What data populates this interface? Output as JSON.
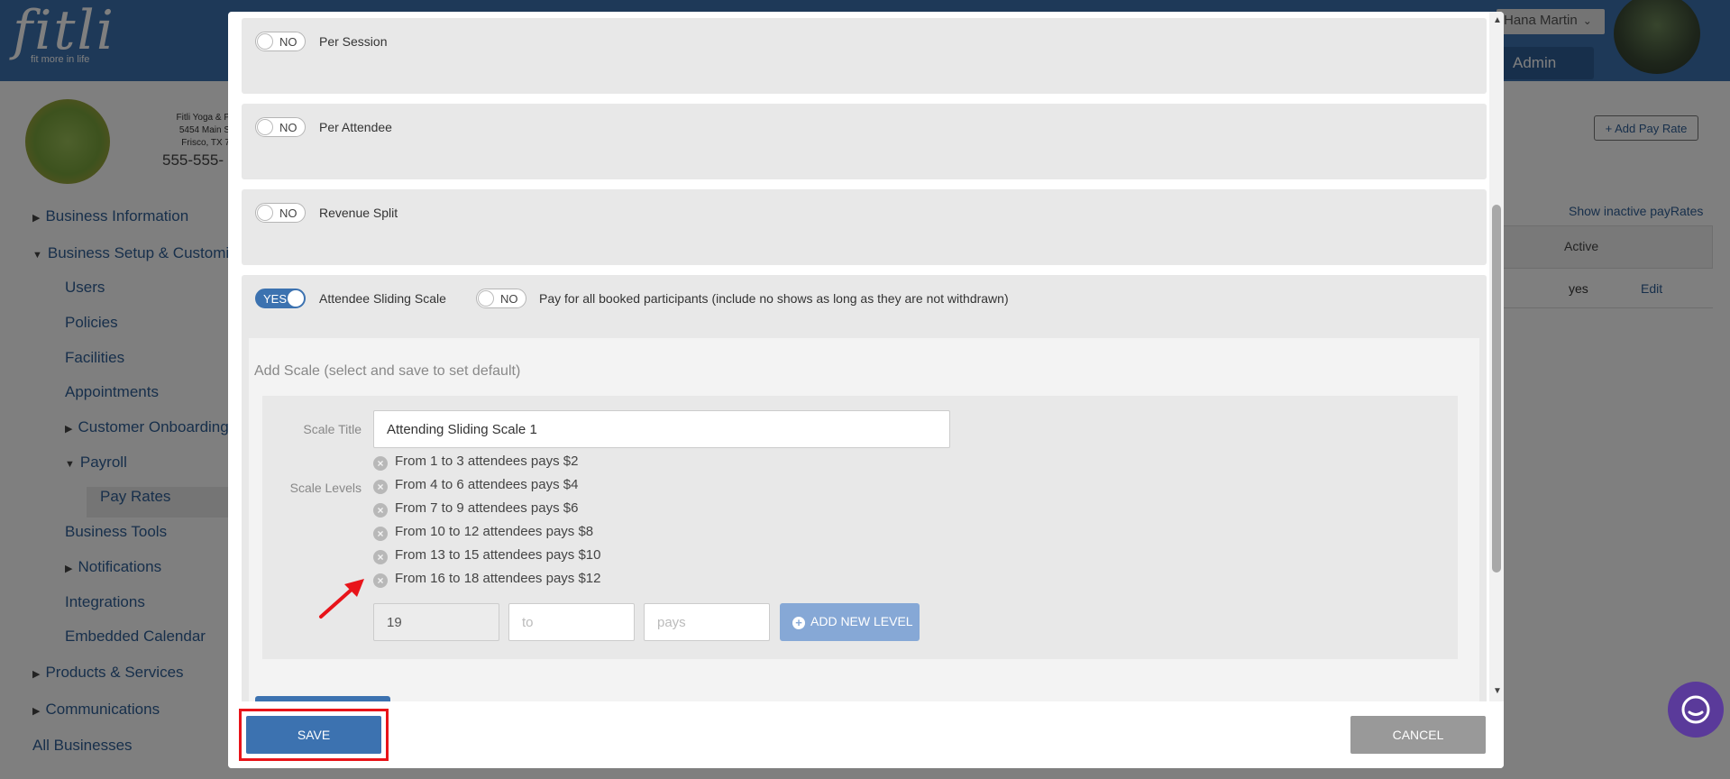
{
  "app": {
    "logo_text": "fitli",
    "logo_tagline": "fit more in life",
    "user_name": "Hana Martin",
    "admin_label": "Admin"
  },
  "business": {
    "name": "Fitli Yoga & P",
    "address_line1": "5454 Main S",
    "address_line2": "Frisco, TX 7",
    "phone": "555-555-"
  },
  "sidebar": {
    "items": [
      {
        "label": "Business Information"
      },
      {
        "label": "Business Setup & Customiza"
      },
      {
        "label": "Users"
      },
      {
        "label": "Policies"
      },
      {
        "label": "Facilities"
      },
      {
        "label": "Appointments"
      },
      {
        "label": "Customer Onboarding"
      },
      {
        "label": "Payroll"
      },
      {
        "label": "Pay Rates"
      },
      {
        "label": "Business Tools"
      },
      {
        "label": "Notifications"
      },
      {
        "label": "Integrations"
      },
      {
        "label": "Embedded Calendar"
      },
      {
        "label": "Products & Services"
      },
      {
        "label": "Communications"
      },
      {
        "label": "All Businesses"
      }
    ]
  },
  "background_page": {
    "add_pay_rate": "+ Add Pay Rate",
    "show_inactive": "Show inactive payRates",
    "table_header_active": "Active",
    "row_active": "yes",
    "row_edit": "Edit"
  },
  "modal": {
    "per_session": {
      "toggle": "NO",
      "label": "Per Session"
    },
    "per_attendee": {
      "toggle": "NO",
      "label": "Per Attendee"
    },
    "revenue_split": {
      "toggle": "NO",
      "label": "Revenue Split"
    },
    "sliding_scale": {
      "toggle": "YES",
      "label": "Attendee Sliding Scale"
    },
    "pay_all": {
      "toggle": "NO",
      "label": "Pay for all booked participants (include no shows as long as they are not withdrawn)"
    },
    "add_scale_title": "Add Scale (select and save to set default)",
    "scale_title_label": "Scale Title",
    "scale_title_value": "Attending Sliding Scale 1",
    "scale_levels_label": "Scale Levels",
    "levels": [
      "From 1 to 3 attendees pays $2",
      "From 4 to 6 attendees pays $4",
      "From 7 to 9 attendees pays $6",
      "From 10 to 12 attendees pays $8",
      "From 13 to 15 attendees pays $10",
      "From 16 to 18 attendees pays $12"
    ],
    "remove_glyph": "×",
    "new_from_value": "19",
    "new_to_placeholder": "to",
    "new_pays_placeholder": "pays",
    "add_level_label": "ADD NEW LEVEL",
    "save_label": "SAVE",
    "cancel_label": "CANCEL"
  },
  "colors": {
    "brand_blue": "#3c72b0",
    "highlight_red": "#e8141a",
    "add_level_blue": "#86a8d6",
    "cancel_gray": "#999999"
  }
}
